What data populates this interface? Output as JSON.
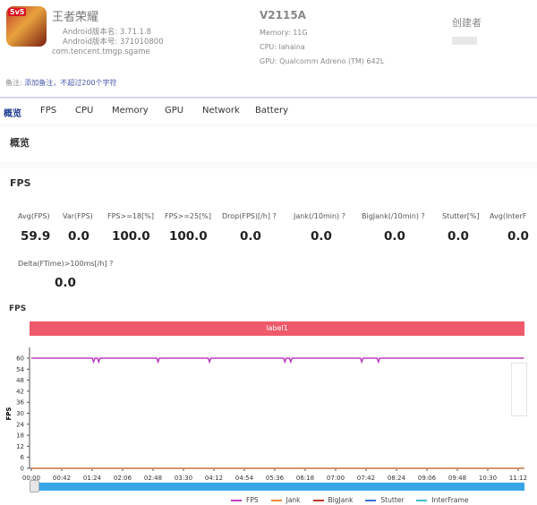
{
  "app": {
    "name": "王者荣耀",
    "version_name": "Android版本名: 3.71.1.8",
    "version_code": "Android版本号: 371010800",
    "package": "com.tencent.tmgp.sgame",
    "icon_badge": "5v5"
  },
  "device": {
    "model": "V2115A",
    "memory": "Memory: 11G",
    "cpu": "CPU: lahaina",
    "gpu": "GPU: Qualcomm Adreno (TM) 642L"
  },
  "creator": {
    "label": "创建者"
  },
  "note": {
    "label": "备注:",
    "link": "添加备注，不超过200个字符"
  },
  "tabs": [
    "概览",
    "FPS",
    "CPU",
    "Memory",
    "GPU",
    "Network",
    "Battery"
  ],
  "overview_title": "概览",
  "fps_section": {
    "title": "FPS",
    "metrics": [
      {
        "label": "Avg(FPS)",
        "value": "59.9"
      },
      {
        "label": "Var(FPS)",
        "value": "0.0"
      },
      {
        "label": "FPS>=18[%]",
        "value": "100.0"
      },
      {
        "label": "FPS>=25[%]",
        "value": "100.0"
      },
      {
        "label": "Drop(FPS)[/h] ?",
        "value": "0.0"
      },
      {
        "label": "Jank(/10min) ?",
        "value": "0.0"
      },
      {
        "label": "BigJank(/10min) ?",
        "value": "0.0"
      },
      {
        "label": "Stutter[%]",
        "value": "0.0"
      },
      {
        "label": "Avg(InterF",
        "value": "0.0"
      },
      {
        "label": "Delta(FTime)>100ms[/h] ?",
        "value": "0.0"
      }
    ]
  },
  "chart_data": {
    "type": "line",
    "title": "FPS",
    "ylabel": "FPS",
    "band_label": "label1",
    "ylim": [
      0,
      60
    ],
    "yticks": [
      0,
      6,
      12,
      18,
      24,
      30,
      36,
      42,
      48,
      54,
      60
    ],
    "xticks": [
      "00:00",
      "00:42",
      "01:24",
      "02:06",
      "02:48",
      "03:30",
      "04:12",
      "04:54",
      "05:36",
      "06:18",
      "07:00",
      "07:42",
      "08:24",
      "09:06",
      "09:48",
      "10:30",
      "11:12"
    ],
    "x_end": "11:20",
    "series": [
      {
        "name": "FPS",
        "color": "#c23fbf",
        "baseline": 60,
        "dips": [
          [
            "01:26",
            58
          ],
          [
            "01:33",
            58
          ],
          [
            "02:55",
            58
          ],
          [
            "04:06",
            58
          ],
          [
            "05:50",
            58
          ],
          [
            "05:58",
            58
          ],
          [
            "07:36",
            58
          ],
          [
            "07:59",
            58
          ]
        ]
      },
      {
        "name": "Jank",
        "color": "#f08a3c",
        "baseline": 0
      },
      {
        "name": "BigJank",
        "color": "#c0392b",
        "baseline": 0
      },
      {
        "name": "Stutter",
        "color": "#3b6fd6",
        "baseline": 0
      },
      {
        "name": "InterFrame",
        "color": "#3bc0c8",
        "baseline": 0
      }
    ]
  }
}
